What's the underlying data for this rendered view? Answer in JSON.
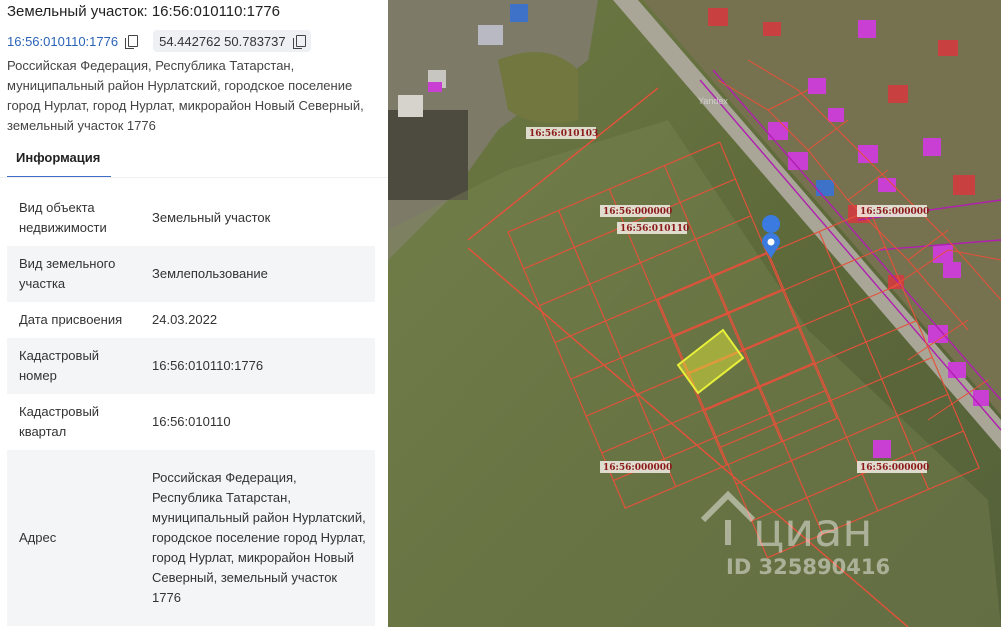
{
  "header": {
    "title": "Земельный участок: 16:56:010110:1776",
    "cadastral_link": "16:56:010110:1776",
    "coordinates": "54.442762 50.783737",
    "address": "Российская Федерация, Республика Татарстан, муниципальный район Нурлатский, городское поселение город Нурлат, город Нурлат, микрорайон Новый Северный, земельный участок 1776"
  },
  "tabs": [
    {
      "label": "Информация"
    }
  ],
  "info": [
    {
      "key": "Вид объекта недвижимости",
      "value": "Земельный участок"
    },
    {
      "key": "Вид земельного участка",
      "value": "Землепользование"
    },
    {
      "key": "Дата присвоения",
      "value": "24.03.2022"
    },
    {
      "key": "Кадастровый номер",
      "value": "16:56:010110:1776"
    },
    {
      "key": "Кадастровый квартал",
      "value": "16:56:010110"
    },
    {
      "key": "Адрес",
      "value": "Российская Федерация, Республика Татарстан, муниципальный район Нурлатский, городское поселение город Нурлат, город Нурлат, микрорайон Новый Северный, земельный участок 1776"
    }
  ],
  "map": {
    "labels": {
      "block_103": "16:56:010103",
      "parcel_top": "16:56:000000",
      "block_110": "16:56:010110",
      "parcel_right": "16:56:000000",
      "parcel_bottom_left": "16:56:000000",
      "parcel_bottom_right": "16:56:000000"
    },
    "watermark": "циан",
    "watermark_id": "ID 325890416",
    "provider": "Yandex",
    "colors": {
      "parcel_line": "#e8503a",
      "selected_parcel": "#e8f03a",
      "pin": "#3b7be0",
      "zone_line": "#b01fb0"
    }
  }
}
